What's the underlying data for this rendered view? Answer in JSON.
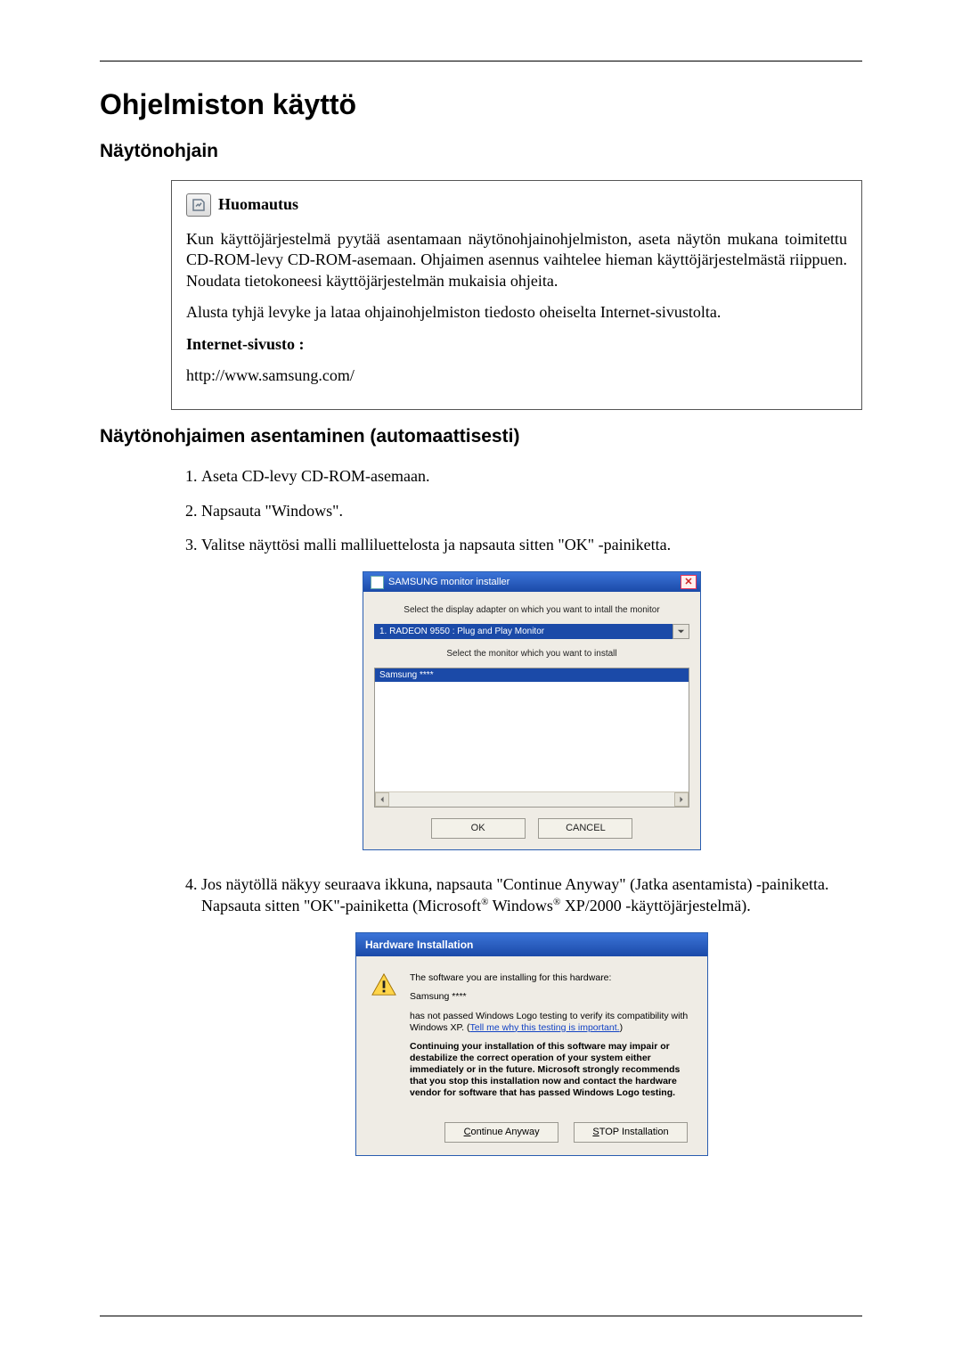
{
  "page": {
    "title": "Ohjelmiston käyttö",
    "section1": "Näytönohjain",
    "section2": "Näytönohjaimen asentaminen (automaattisesti)"
  },
  "note": {
    "heading": "Huomautus",
    "p1": "Kun käyttöjärjestelmä pyytää asentamaan näytönohjainohjelmiston, aseta näytön mukana toimitettu CD-ROM-levy CD-ROM-asemaan. Ohjaimen asennus vaihtelee hieman käyttöjärjestelmästä riippuen. Noudata tietokoneesi käyttöjärjestelmän mukaisia ohjeita.",
    "p2": "Alusta tyhjä levyke ja lataa ohjainohjelmiston tiedosto oheiselta Internet-sivustolta.",
    "site_label": "Internet-sivusto :",
    "url": "http://www.samsung.com/"
  },
  "steps": {
    "s1": "Aseta CD-levy CD-ROM-asemaan.",
    "s2": "Napsauta \"Windows\".",
    "s3": "Valitse näyttösi malli malliluettelosta ja napsauta sitten \"OK\" -painiketta.",
    "s4a": "Jos näytöllä näkyy seuraava ikkuna, napsauta \"Continue Anyway\" (Jatka asentamista) -painiketta. Napsauta sitten \"OK\"-painiketta (Microsoft",
    "s4b": " Windows",
    "s4c": " XP/2000 -käyttöjärjestelmä).",
    "reg": "®"
  },
  "dlg1": {
    "title": "SAMSUNG monitor installer",
    "line1": "Select the display adapter on which you want to intall the monitor",
    "combo_value": "1. RADEON 9550 : Plug and Play Monitor",
    "line2": "Select the monitor which you want to install",
    "list_selected": "Samsung ****",
    "ok": "OK",
    "cancel": "CANCEL"
  },
  "dlg2": {
    "title": "Hardware Installation",
    "p1": "The software you are installing for this hardware:",
    "p2": "Samsung ****",
    "p3a": "has not passed Windows Logo testing to verify its compatibility with Windows XP. (",
    "p3link": "Tell me why this testing is important.",
    "p3b": ")",
    "p4": "Continuing your installation of this software may impair or destabilize the correct operation of your system either immediately or in the future. Microsoft strongly recommends that you stop this installation now and contact the hardware vendor for software that has passed Windows Logo testing.",
    "btn_cont_pre": "C",
    "btn_cont_rest": "ontinue Anyway",
    "btn_stop_pre": "S",
    "btn_stop_rest": "TOP Installation"
  }
}
